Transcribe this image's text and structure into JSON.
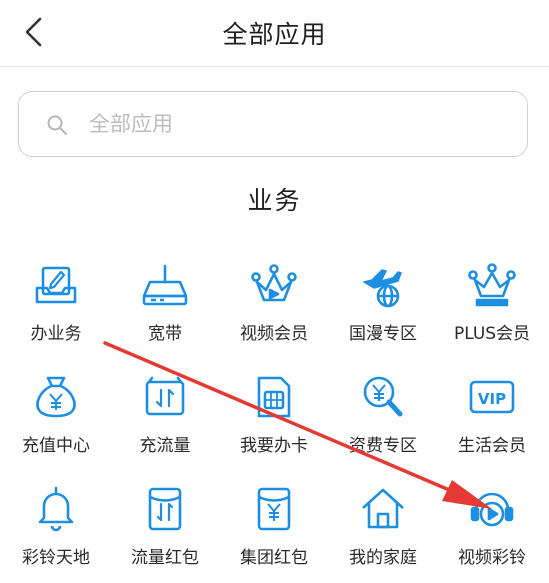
{
  "header": {
    "title": "全部应用"
  },
  "search": {
    "placeholder": "全部应用"
  },
  "section": {
    "title": "业务"
  },
  "apps": [
    {
      "label": "办业务",
      "icon": "business-hall-icon"
    },
    {
      "label": "宽带",
      "icon": "router-icon"
    },
    {
      "label": "视频会员",
      "icon": "crown-icon"
    },
    {
      "label": "国漫专区",
      "icon": "airplane-globe-icon"
    },
    {
      "label": "PLUS会员",
      "icon": "plus-crown-icon"
    },
    {
      "label": "充值中心",
      "icon": "money-bag-icon"
    },
    {
      "label": "充流量",
      "icon": "data-flow-icon"
    },
    {
      "label": "我要办卡",
      "icon": "sim-card-icon"
    },
    {
      "label": "资费专区",
      "icon": "yuan-search-icon"
    },
    {
      "label": "生活会员",
      "icon": "vip-icon"
    },
    {
      "label": "彩铃天地",
      "icon": "bell-icon"
    },
    {
      "label": "流量红包",
      "icon": "data-red-packet-icon"
    },
    {
      "label": "集团红包",
      "icon": "yuan-red-packet-icon"
    },
    {
      "label": "我的家庭",
      "icon": "home-icon"
    },
    {
      "label": "视频彩铃",
      "icon": "video-ringtone-icon"
    }
  ],
  "colors": {
    "icon": "#1e8fe0",
    "arrow": "#e53a34",
    "title": "#1f1f1f"
  }
}
